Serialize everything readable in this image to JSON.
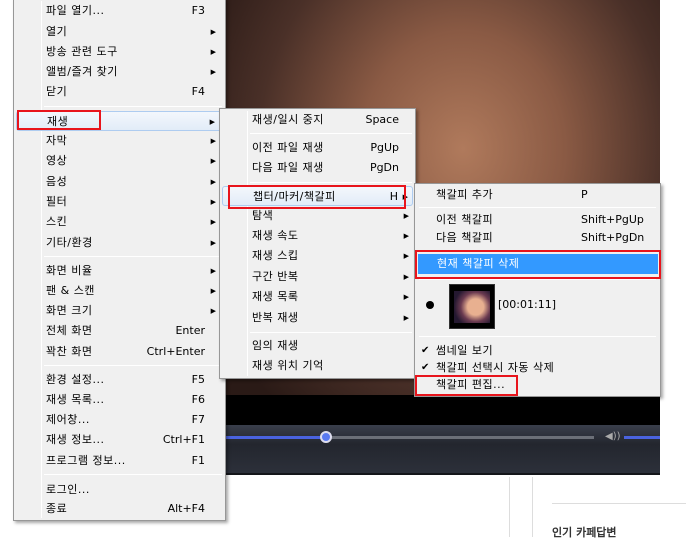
{
  "main_menu": {
    "items": [
      {
        "label": "파일 열기...",
        "shortcut": "F3"
      },
      {
        "label": "열기",
        "submenu": true
      },
      {
        "label": "방송 관련 도구",
        "submenu": true
      },
      {
        "label": "앨범/즐겨 찾기",
        "submenu": true
      },
      {
        "label": "닫기",
        "shortcut": "F4"
      },
      {
        "label": "재생",
        "submenu": true,
        "highlighted": true
      },
      {
        "label": "자막",
        "submenu": true
      },
      {
        "label": "영상",
        "submenu": true
      },
      {
        "label": "음성",
        "submenu": true
      },
      {
        "label": "필터",
        "submenu": true
      },
      {
        "label": "스킨",
        "submenu": true
      },
      {
        "label": "기타/환경",
        "submenu": true
      },
      {
        "label": "화면 비율",
        "submenu": true
      },
      {
        "label": "팬 & 스캔",
        "submenu": true
      },
      {
        "label": "화면 크기",
        "submenu": true
      },
      {
        "label": "전체 화면",
        "shortcut": "Enter"
      },
      {
        "label": "꽉찬 화면",
        "shortcut": "Ctrl+Enter"
      },
      {
        "label": "환경 설정...",
        "shortcut": "F5"
      },
      {
        "label": "재생 목록...",
        "shortcut": "F6"
      },
      {
        "label": "제어창...",
        "shortcut": "F7"
      },
      {
        "label": "재생 정보...",
        "shortcut": "Ctrl+F1"
      },
      {
        "label": "프로그램 정보...",
        "shortcut": "F1"
      },
      {
        "label": "로그인..."
      },
      {
        "label": "종료",
        "shortcut": "Alt+F4"
      }
    ]
  },
  "play_menu": {
    "items": [
      {
        "label": "재생/일시 중지",
        "shortcut": "Space"
      },
      {
        "label": "이전 파일 재생",
        "shortcut": "PgUp"
      },
      {
        "label": "다음 파일 재생",
        "shortcut": "PgDn"
      },
      {
        "label": "챕터/마커/책갈피",
        "shortcut": "H",
        "submenu": true,
        "highlighted": true
      },
      {
        "label": "탐색",
        "submenu": true
      },
      {
        "label": "재생 속도",
        "submenu": true
      },
      {
        "label": "재생 스킵",
        "submenu": true
      },
      {
        "label": "구간 반복",
        "submenu": true
      },
      {
        "label": "재생 목록",
        "submenu": true
      },
      {
        "label": "반복 재생",
        "submenu": true
      },
      {
        "label": "임의 재생"
      },
      {
        "label": "재생 위치 기억"
      }
    ]
  },
  "bookmark_menu": {
    "items": [
      {
        "label": "책갈피 추가",
        "shortcut": "P"
      },
      {
        "label": "이전 책갈피",
        "shortcut": "Shift+PgUp"
      },
      {
        "label": "다음 책갈피",
        "shortcut": "Shift+PgDn"
      },
      {
        "label": "현재 책갈피 삭제",
        "highlighted": true
      },
      {
        "label": "썸네일 보기",
        "checked": true
      },
      {
        "label": "책갈피 선택시 자동 삭제",
        "checked": true
      },
      {
        "label": "책갈피 편집..."
      }
    ],
    "bookmark_entry": {
      "timestamp": "[00:01:11]"
    }
  },
  "player": {
    "seek_progress": 0.28,
    "volume": 1.0
  },
  "page": {
    "partial_text": "인기 카페답변"
  },
  "colors": {
    "highlight": "#3399ff",
    "annotation": "#e8141c",
    "seek": "#4a63e0"
  }
}
